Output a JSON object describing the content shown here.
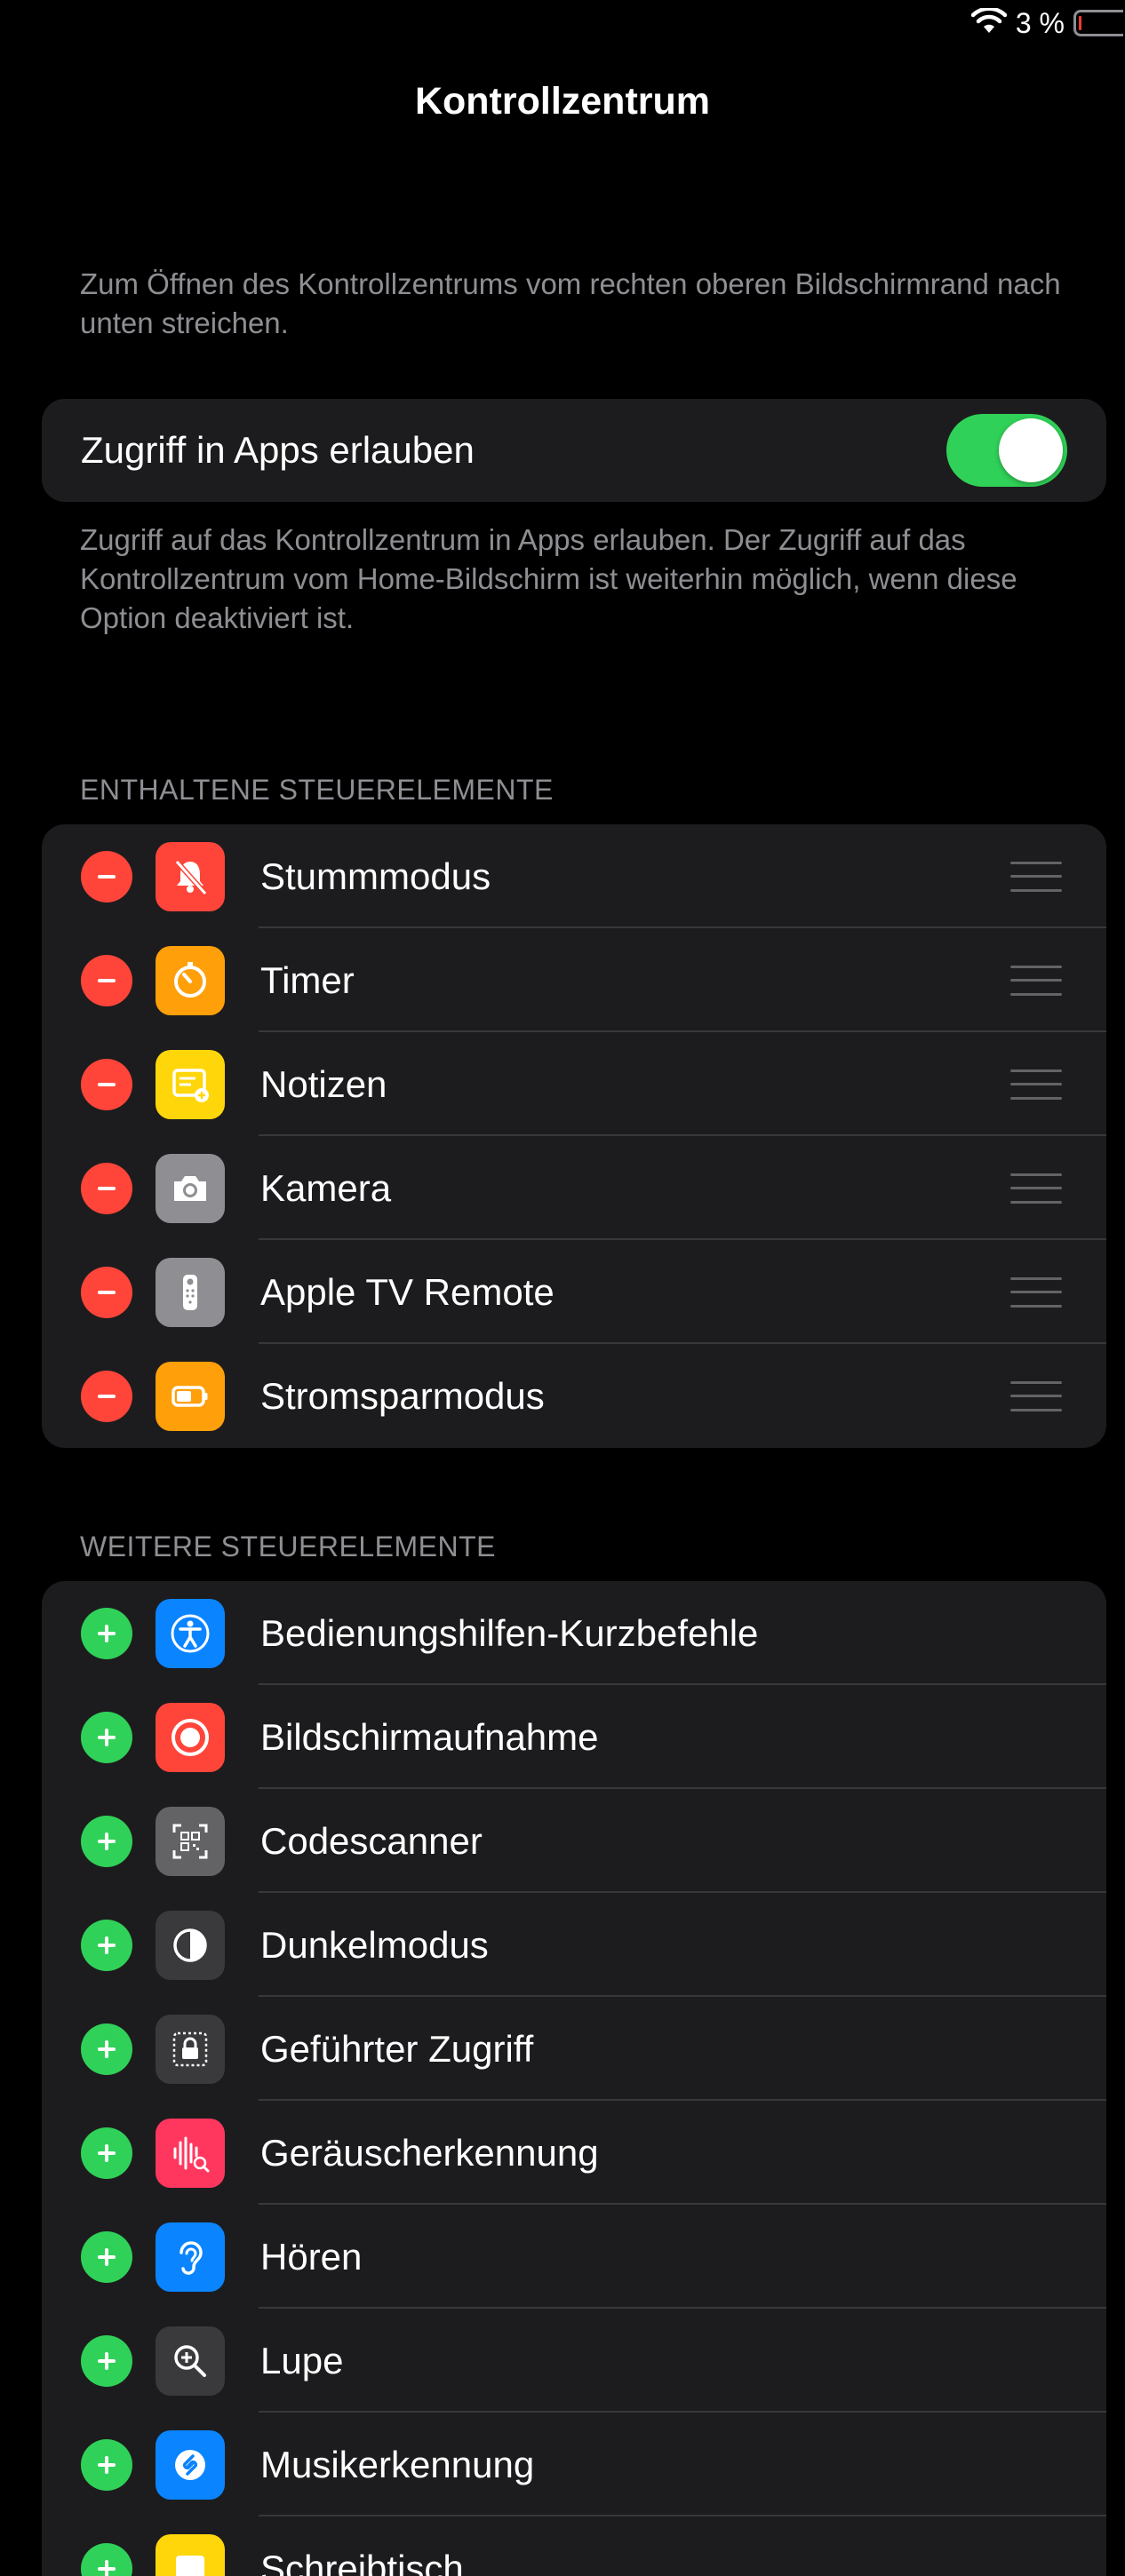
{
  "status_bar": {
    "battery_percent": "3 %",
    "battery_level": 0.03
  },
  "title": "Kontrollzentrum",
  "intro_note": "Zum Öffnen des Kontrollzentrums vom rechten oberen Bildschirmrand nach unten streichen.",
  "access_toggle": {
    "label": "Zugriff in Apps erlauben",
    "on": true
  },
  "access_note": "Zugriff auf das Kontrollzentrum in Apps erlauben. Der Zugriff auf das Kontrollzentrum vom Home-Bildschirm ist weiterhin möglich, wenn diese Option deaktiviert ist.",
  "included": {
    "header": "ENTHALTENE STEUERELEMENTE",
    "items": [
      {
        "label": "Stummmodus",
        "icon": "bell-slash-icon",
        "color": "#ff453a"
      },
      {
        "label": "Timer",
        "icon": "timer-icon",
        "color": "#ff9f0a"
      },
      {
        "label": "Notizen",
        "icon": "notes-icon",
        "color": "#ffd60a"
      },
      {
        "label": "Kamera",
        "icon": "camera-icon",
        "color": "#8e8e93"
      },
      {
        "label": "Apple TV Remote",
        "icon": "remote-icon",
        "color": "#8e8e93"
      },
      {
        "label": "Stromsparmodus",
        "icon": "battery-icon",
        "color": "#ff9f0a"
      }
    ]
  },
  "more": {
    "header": "WEITERE STEUERELEMENTE",
    "items": [
      {
        "label": "Bedienungshilfen-Kurzbefehle",
        "icon": "accessibility-icon",
        "color": "#0a84ff"
      },
      {
        "label": "Bildschirmaufnahme",
        "icon": "screen-record-icon",
        "color": "#ff453a"
      },
      {
        "label": "Codescanner",
        "icon": "qr-code-icon",
        "color": "#636366"
      },
      {
        "label": "Dunkelmodus",
        "icon": "dark-mode-icon",
        "color": "#3a3a3c"
      },
      {
        "label": "Geführter Zugriff",
        "icon": "guided-access-lock-icon",
        "color": "#3a3a3c"
      },
      {
        "label": "Geräuscherkennung",
        "icon": "sound-recognition-icon",
        "color": "#ff375f"
      },
      {
        "label": "Hören",
        "icon": "ear-icon",
        "color": "#0a84ff"
      },
      {
        "label": "Lupe",
        "icon": "magnifier-icon",
        "color": "#3a3a3c"
      },
      {
        "label": "Musikerkennung",
        "icon": "shazam-icon",
        "color": "#0a84ff"
      },
      {
        "label": "Schreibtisch",
        "icon": "notes-yellow-icon",
        "color": "#ffd60a"
      }
    ]
  }
}
